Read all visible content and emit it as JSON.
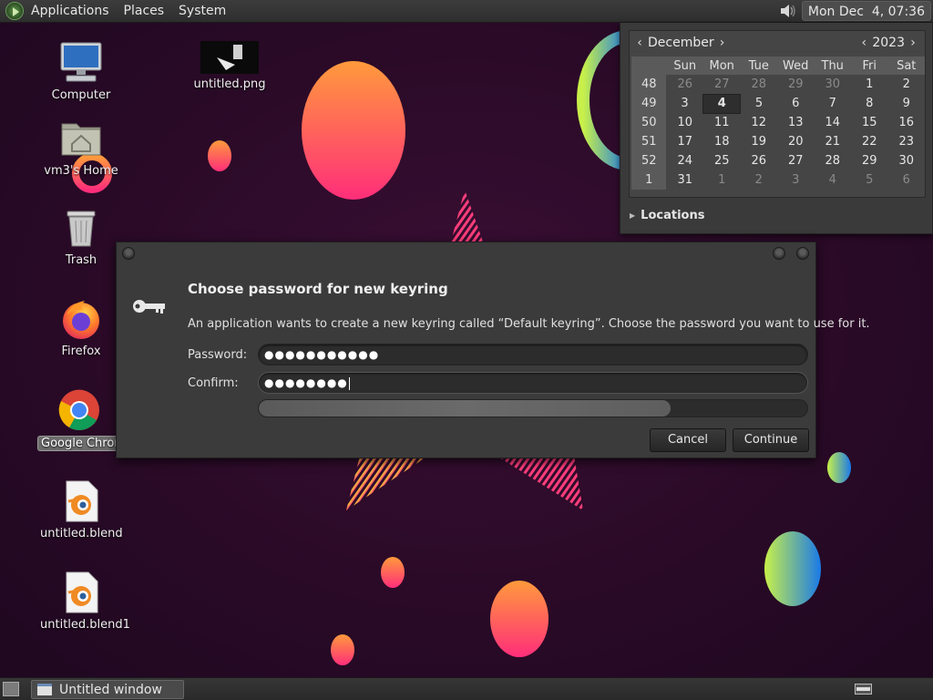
{
  "top_panel": {
    "menus": [
      "Applications",
      "Places",
      "System"
    ],
    "clock": "Mon Dec  4, 07:36"
  },
  "desktop_icons": [
    {
      "label": "Computer",
      "icon": "computer-icon"
    },
    {
      "label": "vm3's Home",
      "icon": "home-folder-icon"
    },
    {
      "label": "Trash",
      "icon": "trash-icon"
    },
    {
      "label": "Firefox",
      "icon": "firefox-icon"
    },
    {
      "label": "Google Chrome",
      "icon": "chrome-icon"
    },
    {
      "label": "untitled.blend",
      "icon": "blender-file-icon"
    },
    {
      "label": "untitled.blend1",
      "icon": "blender-file-icon"
    },
    {
      "label": "untitled.png",
      "icon": "image-file-icon"
    }
  ],
  "calendar": {
    "month": "December",
    "year": "2023",
    "weekdays": [
      "Sun",
      "Mon",
      "Tue",
      "Wed",
      "Thu",
      "Fri",
      "Sat"
    ],
    "weeks": [
      {
        "num": "48",
        "days": [
          "26",
          "27",
          "28",
          "29",
          "30",
          "1",
          "2"
        ]
      },
      {
        "num": "49",
        "days": [
          "3",
          "4",
          "5",
          "6",
          "7",
          "8",
          "9"
        ]
      },
      {
        "num": "50",
        "days": [
          "10",
          "11",
          "12",
          "13",
          "14",
          "15",
          "16"
        ]
      },
      {
        "num": "51",
        "days": [
          "17",
          "18",
          "19",
          "20",
          "21",
          "22",
          "23"
        ]
      },
      {
        "num": "52",
        "days": [
          "24",
          "25",
          "26",
          "27",
          "28",
          "29",
          "30"
        ]
      },
      {
        "num": "1",
        "days": [
          "31",
          "1",
          "2",
          "3",
          "4",
          "5",
          "6"
        ]
      }
    ],
    "today": "4",
    "locations_label": "Locations"
  },
  "dialog": {
    "title": "Choose password for new keyring",
    "message": "An application wants to create a new keyring called “Default keyring”. Choose the password you want to use for it.",
    "password_label": "Password:",
    "password_value": "●●●●●●●●●●●",
    "confirm_label": "Confirm:",
    "confirm_value": "●●●●●●●●",
    "strength_fraction": 0.75,
    "cancel_label": "Cancel",
    "continue_label": "Continue"
  },
  "taskbar": {
    "window_title": "Untitled window"
  },
  "colors": {
    "wallpaper": "#2a0a27",
    "panel": "#333333",
    "dialog_bg": "#3b3b3b"
  }
}
